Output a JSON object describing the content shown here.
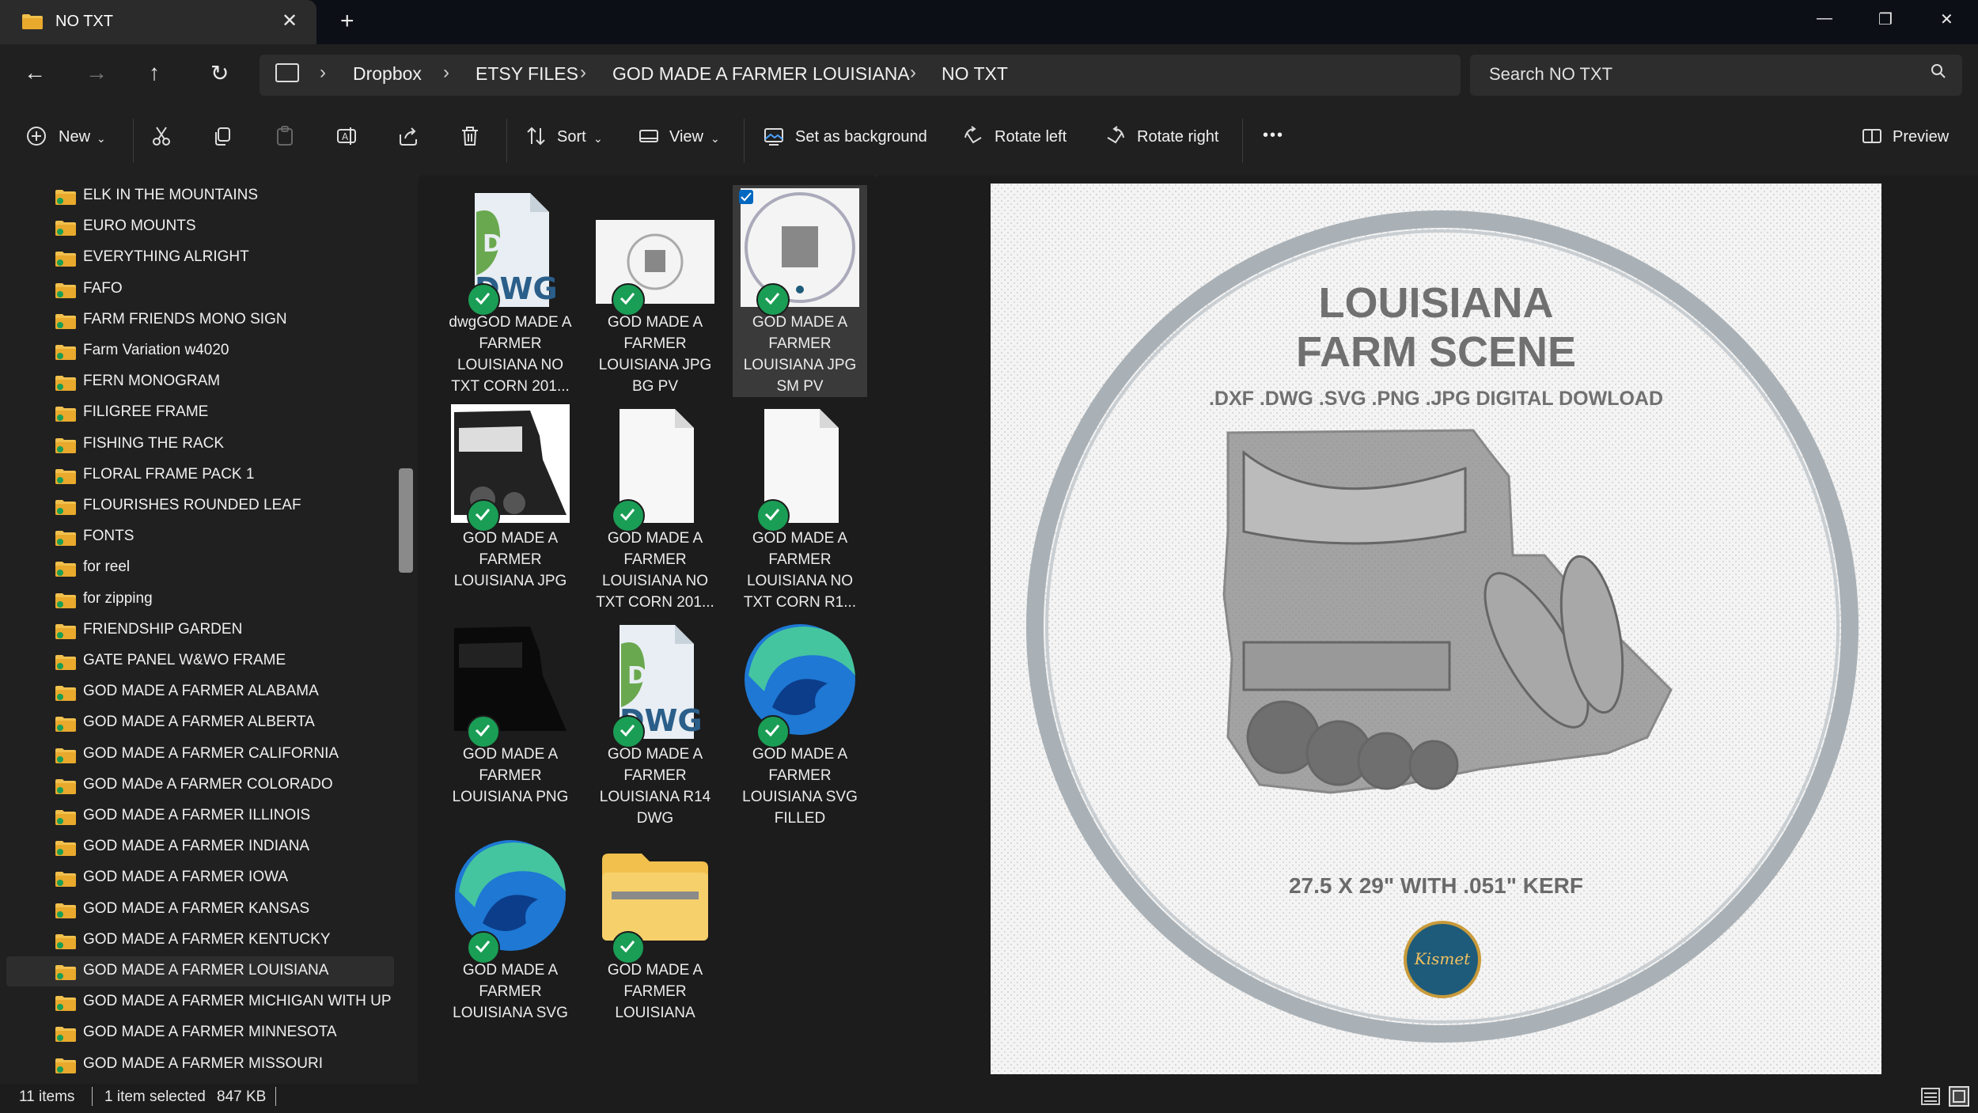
{
  "window": {
    "tab_title": "NO TXT",
    "minimize": "—",
    "restore": "❐",
    "close": "✕",
    "tab_close": "✕",
    "tab_new": "+"
  },
  "nav": {
    "back": "←",
    "forward": "→",
    "up": "↑",
    "refresh": "↻"
  },
  "breadcrumb": [
    "Dropbox",
    "ETSY FILES",
    "GOD MADE A FARMER LOUISIANA",
    "NO TXT"
  ],
  "search": {
    "placeholder": "Search NO TXT"
  },
  "toolbar": {
    "new_label": "New",
    "sort_label": "Sort",
    "view_label": "View",
    "set_background_label": "Set as background",
    "rotate_left_label": "Rotate left",
    "rotate_right_label": "Rotate right",
    "more_label": "•••",
    "preview_label": "Preview"
  },
  "sidebar": {
    "items": [
      "ELK IN THE MOUNTAINS",
      "EURO MOUNTS",
      "EVERYTHING ALRIGHT",
      "FAFO",
      "FARM FRIENDS MONO SIGN",
      "Farm Variation w4020",
      "FERN MONOGRAM",
      "FILIGREE FRAME",
      "FISHING THE RACK",
      "FLORAL FRAME PACK 1",
      "FLOURISHES ROUNDED LEAF",
      "FONTS",
      "for reel",
      "for zipping",
      "FRIENDSHIP GARDEN",
      "GATE PANEL W&WO FRAME",
      "GOD MADE A FARMER ALABAMA",
      "GOD MADE A FARMER ALBERTA",
      "GOD MADE A FARMER CALIFORNIA",
      "GOD MADe A FARMER COLORADO",
      "GOD MADE A FARMER ILLINOIS",
      "GOD MADE A FARMER INDIANA",
      "GOD MADE A FARMER IOWA",
      "GOD MADE A FARMER KANSAS",
      "GOD MADE A FARMER KENTUCKY",
      "GOD MADE A FARMER LOUISIANA",
      "GOD MADE A FARMER MICHIGAN WITH UP",
      "GOD MADE A FARMER MINNESOTA",
      "GOD MADE A FARMER MISSOURI"
    ],
    "selected_index": 25
  },
  "files": [
    {
      "name": "dwgGOD MADE A FARMER LOUISIANA NO TXT CORN 201...",
      "kind": "dwg"
    },
    {
      "name": "GOD MADE A FARMER LOUISIANA JPG BG PV",
      "kind": "bgpv"
    },
    {
      "name": "GOD MADE A FARMER LOUISIANA JPG SM PV",
      "kind": "smpv",
      "selected": true
    },
    {
      "name": "GOD MADE A FARMER LOUISIANA JPG",
      "kind": "art"
    },
    {
      "name": "GOD MADE A FARMER LOUISIANA NO TXT CORN 201...",
      "kind": "blank"
    },
    {
      "name": "GOD MADE A FARMER LOUISIANA NO TXT CORN R1...",
      "kind": "blank"
    },
    {
      "name": "GOD MADE A FARMER LOUISIANA PNG",
      "kind": "png"
    },
    {
      "name": "GOD MADE A FARMER LOUISIANA R14 DWG",
      "kind": "dwg"
    },
    {
      "name": "GOD MADE A FARMER LOUISIANA SVG FILLED",
      "kind": "edge"
    },
    {
      "name": "GOD MADE A FARMER LOUISIANA SVG",
      "kind": "edge"
    },
    {
      "name": "GOD MADE A FARMER LOUISIANA",
      "kind": "zip"
    }
  ],
  "dwg_badge": "DWG",
  "dwg_ds": "Ds",
  "preview": {
    "title_line1": "LOUISIANA",
    "title_line2": "FARM SCENE",
    "subtitle": ".DXF .DWG .SVG .PNG .JPG DIGITAL DOWLOAD",
    "dimensions": "27.5 X 29\" WITH .051\" KERF",
    "logo_text": "Kismet"
  },
  "status": {
    "count": "11 items",
    "selection": "1 item selected",
    "size": "847 KB"
  },
  "colors": {
    "check": "#1a9e55",
    "folder": "#e8b83a",
    "accent": "#0067c0"
  }
}
